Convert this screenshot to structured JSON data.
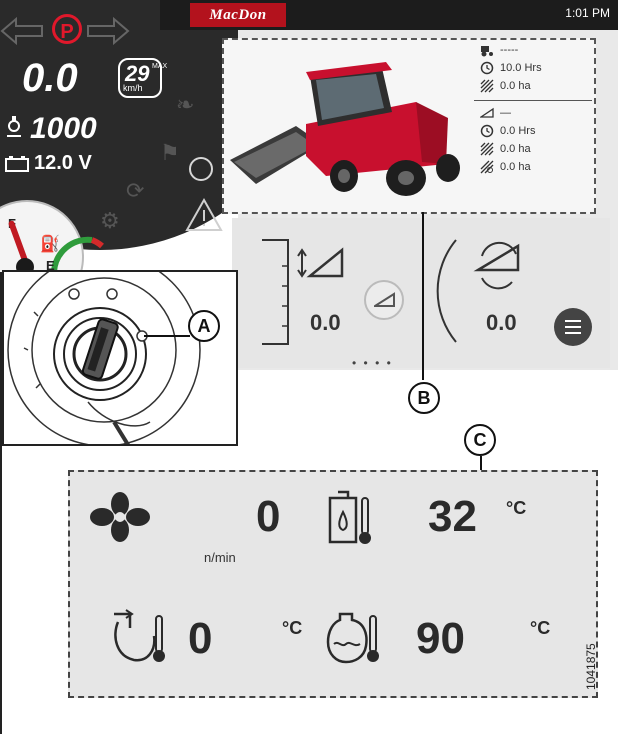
{
  "header": {
    "brand": "MacDon",
    "time": "1:01 PM"
  },
  "dashboard": {
    "speed": "0.0",
    "max_speed": "29",
    "max_label": "MAX",
    "speed_unit": "km/h",
    "engine_rpm": "1000",
    "voltage": "12.0 V",
    "parking_brake": "P",
    "fuel_full": "F",
    "fuel_empty": "E"
  },
  "machine_stats": {
    "header_dash": "-----",
    "engine_hours": "10.0 Hrs",
    "area_1": "0.0 ha",
    "header_dash_2": "—",
    "header_hours": "0.0 Hrs",
    "area_2": "0.0 ha",
    "area_3": "0.0 ha"
  },
  "header_controls": {
    "height_value": "0.0",
    "tilt_value": "0.0",
    "page_indicator": "• • • •"
  },
  "callouts": {
    "a": "A",
    "b": "B",
    "c": "C"
  },
  "engine_panel": {
    "fan_speed": "0",
    "fan_unit": "n/min",
    "hydraulic_temp": "32",
    "hydraulic_unit": "°C",
    "intake_temp": "0",
    "intake_unit": "°C",
    "coolant_temp": "90",
    "coolant_unit": "°C"
  },
  "figure_number": "1041875",
  "colors": {
    "brand_red": "#b3121d",
    "alert_red": "#e0182b",
    "dash_dark": "#2a2a2a"
  }
}
